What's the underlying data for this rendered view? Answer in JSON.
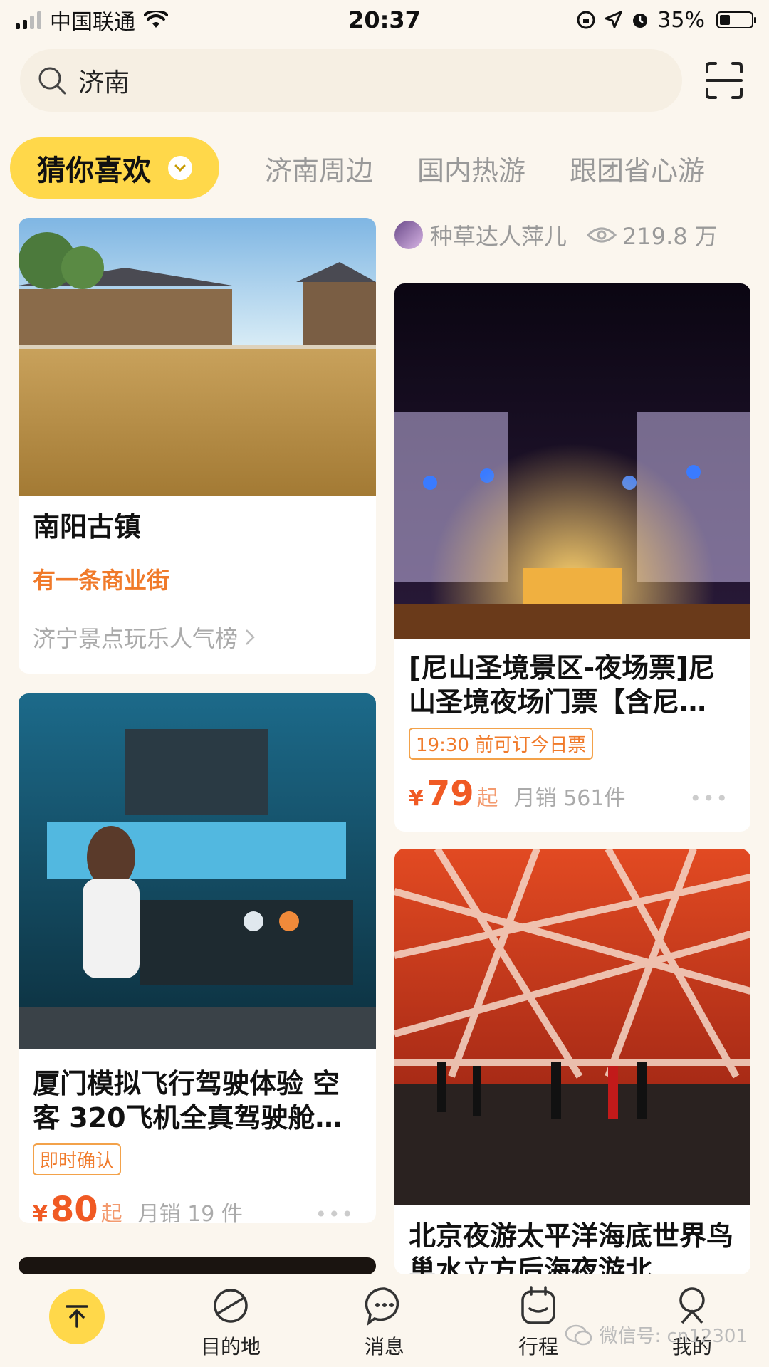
{
  "status_bar": {
    "carrier": "中国联通",
    "time": "20:37",
    "battery": "35%"
  },
  "search": {
    "value": "济南"
  },
  "tabs": {
    "active": "猜你喜欢",
    "items": [
      "济南周边",
      "国内热游",
      "跟团省心游"
    ]
  },
  "feed": {
    "author": {
      "name": "种草达人萍儿",
      "views": "219.8 万"
    },
    "cards": [
      {
        "title": "南阳古镇",
        "subtitle": "有一条商业街",
        "link": "济宁景点玩乐人气榜"
      },
      {
        "title": "[尼山圣境景区-夜场票]尼山圣境夜场门票【含尼…",
        "badge": "19:30 前可订今日票",
        "price_symbol": "¥",
        "price": "79",
        "price_suffix": "起",
        "sales": "月销 561件"
      },
      {
        "title": "厦门模拟飞行驾驶体验 空客 320飞机全真驾驶舱…",
        "badge": "即时确认",
        "price_symbol": "¥",
        "price": "80",
        "price_suffix": "起",
        "sales": "月销 19 件"
      },
      {
        "title": "北京夜游太平洋海底世界鸟巢水立方后海夜游北"
      }
    ]
  },
  "bottom_nav": {
    "items": [
      {
        "label": ""
      },
      {
        "label": "目的地"
      },
      {
        "label": "消息"
      },
      {
        "label": "行程"
      },
      {
        "label": "我的"
      }
    ]
  },
  "watermark": "微信号: cn12301",
  "colors": {
    "accent": "#ffd84a",
    "price": "#f05a24",
    "background": "#fbf6ee"
  }
}
